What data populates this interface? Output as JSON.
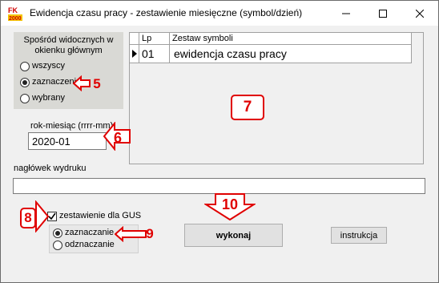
{
  "window": {
    "title": "Ewidencja czasu pracy - zestawienie miesięczne  (symbol/dzień)",
    "app_icon": "fk-app-icon",
    "controls": [
      "minimize-icon",
      "maximize-icon",
      "close-icon"
    ]
  },
  "employees_panel": {
    "title": "Spośród widocznych w okienku głównym",
    "options": [
      {
        "label": "wszyscy",
        "checked": false
      },
      {
        "label": "zaznaczeni",
        "checked": true
      },
      {
        "label": "wybrany",
        "checked": false
      }
    ]
  },
  "period": {
    "label": "rok-miesiąc (rrrr-mm)",
    "value": "2020-01"
  },
  "symbol_sets": {
    "columns": [
      "Lp",
      "Zestaw symboli"
    ],
    "rows": [
      {
        "lp": "01",
        "name": "ewidencja czasu pracy",
        "current": true
      }
    ]
  },
  "print_header": {
    "label": "nagłówek wydruku",
    "value": ""
  },
  "gus": {
    "checkbox_label": "zestawienie dla GUS",
    "checked": true,
    "options": [
      {
        "label": "zaznaczanie",
        "checked": true
      },
      {
        "label": "odznaczanie",
        "checked": false
      }
    ]
  },
  "buttons": {
    "execute": "wykonaj",
    "instructions": "instrukcja"
  },
  "annotations": {
    "n5": "5",
    "n6": "6",
    "n7": "7",
    "n8": "8",
    "n9": "9",
    "n10": "10",
    "color": "#e00000"
  }
}
